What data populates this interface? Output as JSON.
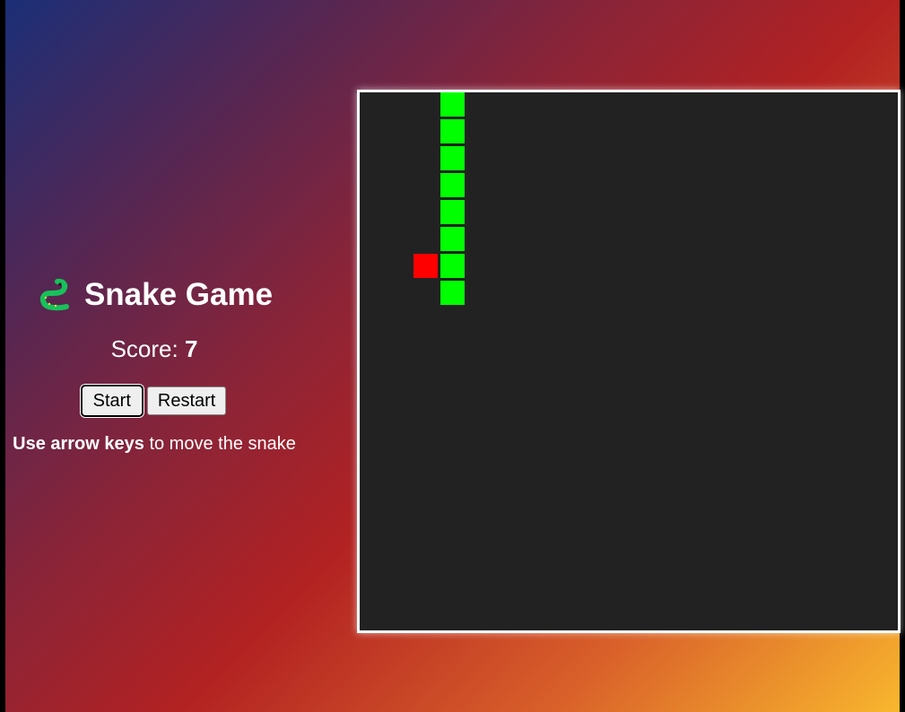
{
  "header": {
    "title": "Snake Game",
    "icon": "snake-icon"
  },
  "score": {
    "label": "Score:",
    "value": "7"
  },
  "controls": {
    "start_label": "Start",
    "restart_label": "Restart"
  },
  "hint": {
    "bold": "Use arrow keys",
    "rest": " to move the snake"
  },
  "board": {
    "grid_cols": 20,
    "grid_rows": 20,
    "snake": [
      {
        "col": 3,
        "row": 0
      },
      {
        "col": 3,
        "row": 1
      },
      {
        "col": 3,
        "row": 2
      },
      {
        "col": 3,
        "row": 3
      },
      {
        "col": 3,
        "row": 4
      },
      {
        "col": 3,
        "row": 5
      },
      {
        "col": 3,
        "row": 6
      },
      {
        "col": 3,
        "row": 7
      }
    ],
    "food": {
      "col": 2,
      "row": 6
    },
    "colors": {
      "background": "#222222",
      "snake": "#00ff00",
      "food": "#ff0000"
    }
  }
}
